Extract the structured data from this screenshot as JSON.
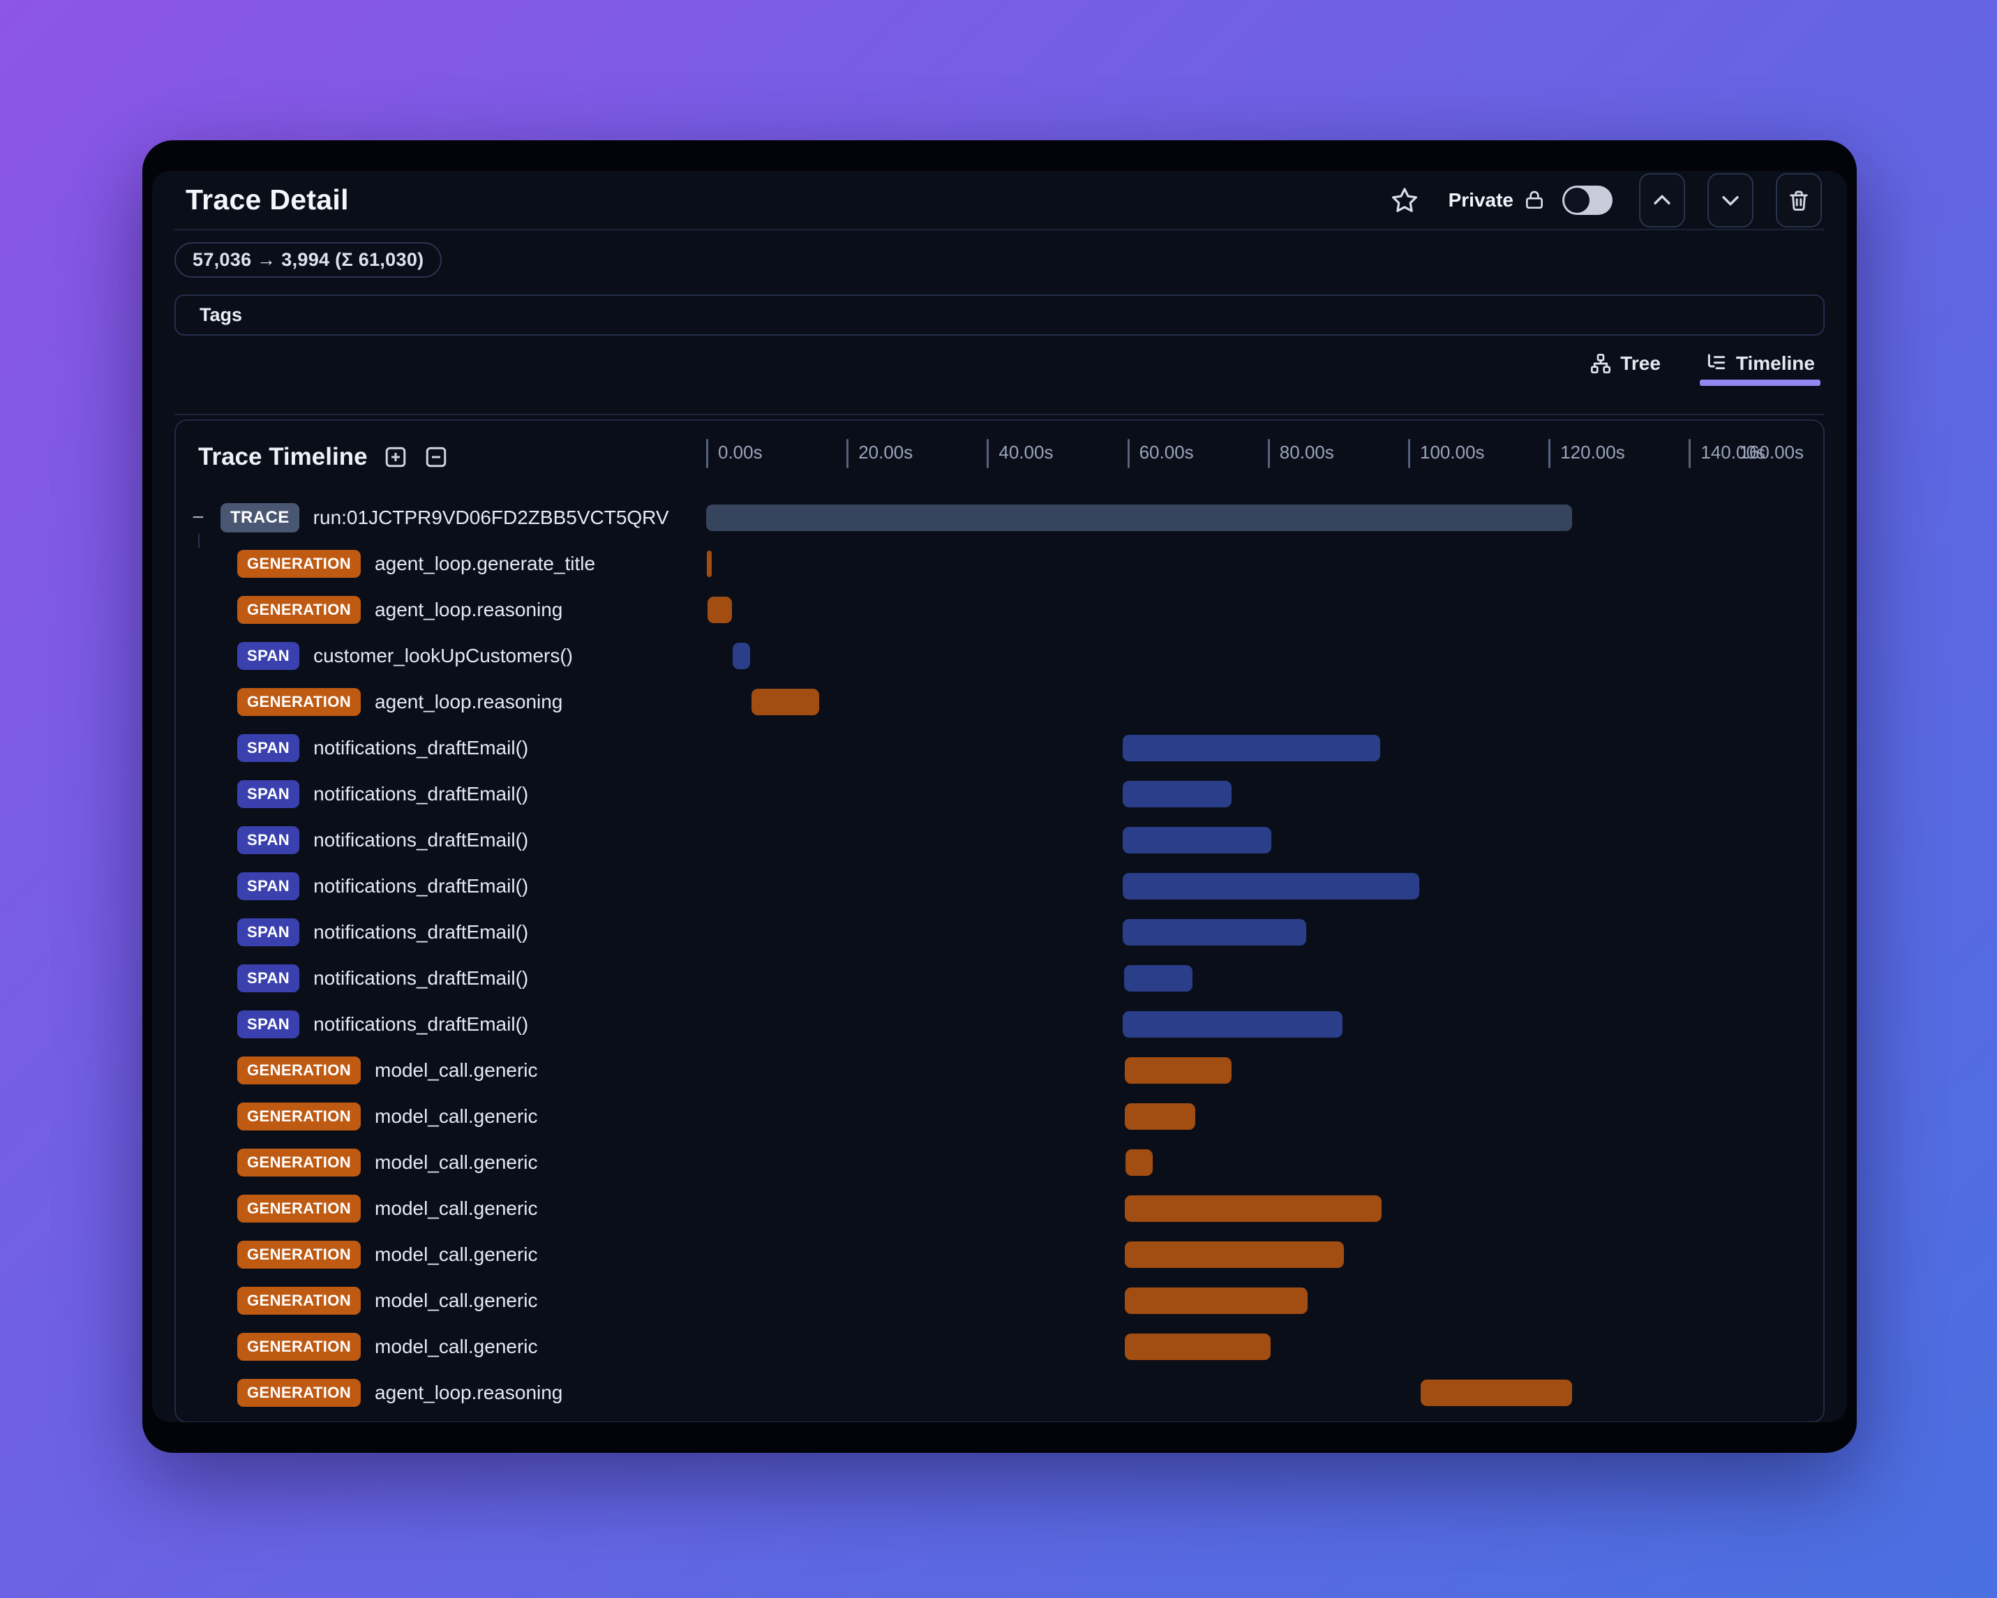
{
  "window": {
    "title": "Trace Detail",
    "header": {
      "privacy_label": "Private",
      "privacy_toggle_state": "off",
      "star_icon": "star-icon",
      "lock_icon": "lock-icon",
      "nav_up_icon": "chevron-up-icon",
      "nav_down_icon": "chevron-down-icon",
      "delete_icon": "trash-icon"
    },
    "token_badge": "57,036 → 3,994 (Σ 61,030)",
    "tags_label": "Tags",
    "view_tabs": [
      {
        "label": "Tree",
        "icon": "tree-icon",
        "active": false
      },
      {
        "label": "Timeline",
        "icon": "list-tree-icon",
        "active": true
      }
    ]
  },
  "timeline": {
    "title": "Trace Timeline",
    "expand_icon": "plus-square-icon",
    "collapse_icon": "minus-square-icon",
    "collapse_glyph": "−",
    "axis": {
      "tick_labels": [
        "0.00s",
        "20.00s",
        "40.00s",
        "60.00s",
        "80.00s",
        "100.00s",
        "120.00s",
        "140.00s"
      ],
      "end_label": "160.00s",
      "tick_interval_s": 20,
      "max_seconds": 163
    },
    "rows": [
      {
        "badge": "TRACE",
        "kind": "trace",
        "name": "run:01JCTPR9VD06FD2ZBB5VCT5QRV",
        "start_s": 0.0,
        "end_s": 123.4,
        "root": true
      },
      {
        "badge": "GENERATION",
        "kind": "generation",
        "name": "agent_loop.generate_title",
        "start_s": 0.1,
        "end_s": 0.8
      },
      {
        "badge": "GENERATION",
        "kind": "generation",
        "name": "agent_loop.reasoning",
        "start_s": 0.2,
        "end_s": 3.7
      },
      {
        "badge": "SPAN",
        "kind": "span",
        "name": "customer_lookUpCustomers()",
        "start_s": 3.8,
        "end_s": 6.3
      },
      {
        "badge": "GENERATION",
        "kind": "generation",
        "name": "agent_loop.reasoning",
        "start_s": 6.5,
        "end_s": 16.1
      },
      {
        "badge": "SPAN",
        "kind": "span",
        "name": "notifications_draftEmail()",
        "start_s": 59.3,
        "end_s": 96.0
      },
      {
        "badge": "SPAN",
        "kind": "span",
        "name": "notifications_draftEmail()",
        "start_s": 59.3,
        "end_s": 74.9
      },
      {
        "badge": "SPAN",
        "kind": "span",
        "name": "notifications_draftEmail()",
        "start_s": 59.3,
        "end_s": 80.5
      },
      {
        "badge": "SPAN",
        "kind": "span",
        "name": "notifications_draftEmail()",
        "start_s": 59.3,
        "end_s": 101.6
      },
      {
        "badge": "SPAN",
        "kind": "span",
        "name": "notifications_draftEmail()",
        "start_s": 59.3,
        "end_s": 85.5
      },
      {
        "badge": "SPAN",
        "kind": "span",
        "name": "notifications_draftEmail()",
        "start_s": 59.5,
        "end_s": 69.3
      },
      {
        "badge": "SPAN",
        "kind": "span",
        "name": "notifications_draftEmail()",
        "start_s": 59.3,
        "end_s": 90.7
      },
      {
        "badge": "GENERATION",
        "kind": "generation",
        "name": "model_call.generic",
        "start_s": 59.6,
        "end_s": 74.9
      },
      {
        "badge": "GENERATION",
        "kind": "generation",
        "name": "model_call.generic",
        "start_s": 59.6,
        "end_s": 69.7
      },
      {
        "badge": "GENERATION",
        "kind": "generation",
        "name": "model_call.generic",
        "start_s": 59.7,
        "end_s": 63.6
      },
      {
        "badge": "GENERATION",
        "kind": "generation",
        "name": "model_call.generic",
        "start_s": 59.6,
        "end_s": 96.2
      },
      {
        "badge": "GENERATION",
        "kind": "generation",
        "name": "model_call.generic",
        "start_s": 59.6,
        "end_s": 90.9
      },
      {
        "badge": "GENERATION",
        "kind": "generation",
        "name": "model_call.generic",
        "start_s": 59.6,
        "end_s": 85.7
      },
      {
        "badge": "GENERATION",
        "kind": "generation",
        "name": "model_call.generic",
        "start_s": 59.6,
        "end_s": 80.4
      },
      {
        "badge": "GENERATION",
        "kind": "generation",
        "name": "agent_loop.reasoning",
        "start_s": 101.8,
        "end_s": 123.4
      }
    ]
  },
  "colors": {
    "accent_tab_underline": "#9189f0",
    "trace_bar": "#37445e",
    "generation_bar": "#a24d12",
    "span_bar": "#2a3e8a",
    "generation_badge": "#bf5a13",
    "span_badge": "#3a41ae",
    "trace_badge": "#4a5773",
    "background_gradient_start": "#8d55e8",
    "background_gradient_end": "#4a6fe0",
    "surface": "#0a0e19"
  }
}
